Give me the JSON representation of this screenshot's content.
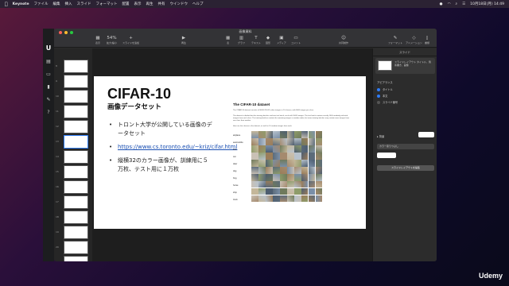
{
  "menubar": {
    "app": "Keynote",
    "menus": [
      "ファイル",
      "編集",
      "挿入",
      "スライド",
      "フォーマット",
      "配置",
      "表示",
      "再生",
      "共有",
      "ウインドウ",
      "ヘルプ"
    ],
    "clock": "10月18日(月) 14:49"
  },
  "window": {
    "title": "画像資料",
    "zoom": "54%",
    "tools": [
      {
        "label": "表示",
        "icon": "sidebar-icon"
      },
      {
        "label": "拡大/縮小",
        "icon": "zoom-icon"
      },
      {
        "label": "スライドを追加",
        "icon": "plus-icon"
      },
      {
        "label": "再生",
        "icon": "play-icon"
      },
      {
        "label": "表",
        "icon": "table-icon"
      },
      {
        "label": "グラフ",
        "icon": "chart-icon"
      },
      {
        "label": "テキスト",
        "icon": "text-icon"
      },
      {
        "label": "図形",
        "icon": "shape-icon"
      },
      {
        "label": "メディア",
        "icon": "media-icon"
      },
      {
        "label": "コメント",
        "icon": "comment-icon"
      },
      {
        "label": "共同制作",
        "icon": "collab-icon"
      },
      {
        "label": "フォーマット",
        "icon": "format-icon"
      },
      {
        "label": "アニメーション",
        "icon": "animation-icon"
      },
      {
        "label": "書類",
        "icon": "document-icon"
      }
    ]
  },
  "slide": {
    "title": "CIFAR-10",
    "subtitle": "画像データセット",
    "bullets": [
      {
        "text": "トロント大学が公開している画像のデータセット"
      },
      {
        "link": "https://www.cs.toronto.edu/~kriz/cifar.html"
      },
      {
        "text": "縦横32のカラー画像が、訓練用に５万枚、テスト用に１万枚"
      }
    ],
    "dataset": {
      "heading": "The CIFAR-10 dataset",
      "p1": "The CIFAR-10 dataset consists of 60000 32x32 colour images in 10 classes, with 6000 images per class.",
      "p2": "The dataset is divided into five training batches and one test batch, each with 10000 images. The test batch contains exactly 1000 randomly-selected images from each class. The training batches contain the remaining images in random order, but some training batches may contain more images from one class than another.",
      "p3": "Here are the classes in the dataset, as well as 10 random images from each:",
      "classes": [
        "airplane",
        "automobile",
        "bird",
        "cat",
        "deer",
        "dog",
        "frog",
        "horse",
        "ship",
        "truck"
      ]
    }
  },
  "inspector": {
    "tab": "スライド",
    "layout_name": "スライドレイアウト タイトル、箇条書き、画像",
    "appearance_label": "アピアランス",
    "options": [
      {
        "label": "タイトル",
        "on": true
      },
      {
        "label": "本文",
        "on": true
      },
      {
        "label": "スライド番号",
        "on": false
      }
    ],
    "background_label": "背景",
    "background_select": "カラー塗りつぶし",
    "edit_layout": "スライドレイアウトを編集"
  },
  "nav": {
    "slide_numbers": [
      "8",
      "9",
      "10",
      "11",
      "12",
      "13",
      "14",
      "15",
      "16",
      "17",
      "18",
      "19",
      "20",
      "21"
    ],
    "selected": "13"
  },
  "watermark": "Udemy"
}
